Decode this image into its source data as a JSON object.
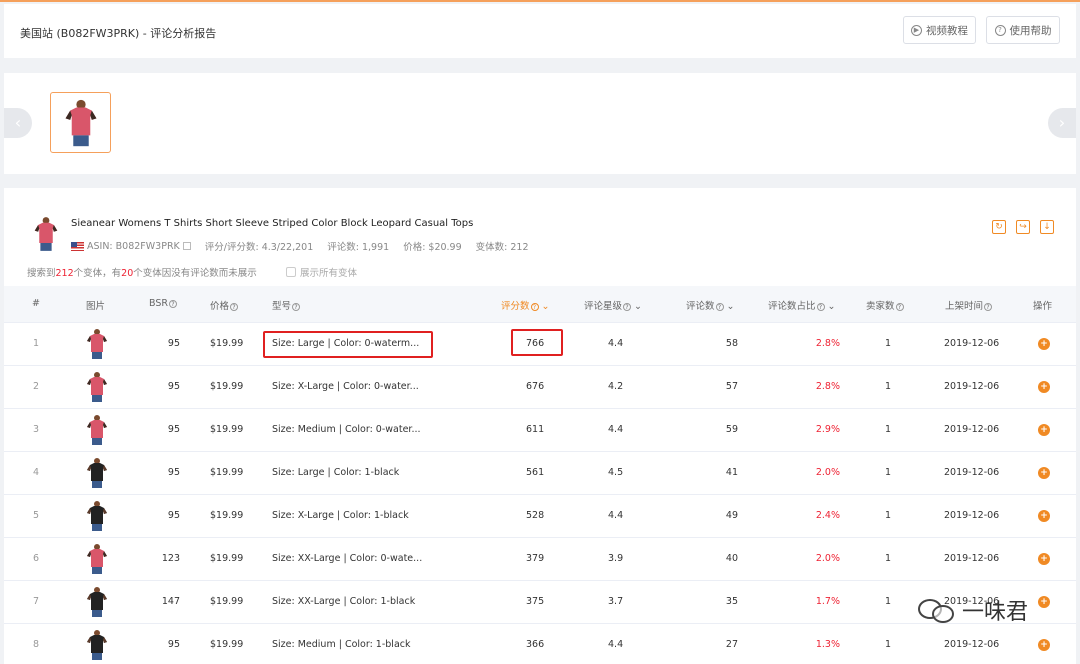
{
  "header": {
    "title": "美国站 (B082FW3PRK) - 评论分析报告",
    "video_label": "视频教程",
    "help_label": "使用帮助"
  },
  "gallery": {
    "prev_icon": "chevron-left-icon",
    "next_icon": "chevron-right-icon"
  },
  "product": {
    "title": "Sieanear Womens T Shirts Short Sleeve Striped Color Block Leopard Casual Tops",
    "asin": "ASIN: B082FW3PRK",
    "rating": "评分/评分数: 4.3/22,201",
    "reviews": "评论数: 1,991",
    "price": "价格: $20.99",
    "variants": "变体数: 212"
  },
  "variants_note": {
    "prefix": "搜索到",
    "count": "212",
    "mid": "个变体，有",
    "no_review_count": "20",
    "suffix": "个变体因没有评论数而未展示",
    "show_all_label": "展示所有变体"
  },
  "table": {
    "headers": {
      "index": "#",
      "image": "图片",
      "bsr": "BSR",
      "price": "价格",
      "model": "型号",
      "ratings": "评分数",
      "stars": "评论星级",
      "reviews": "评论数",
      "review_ratio": "评论数占比",
      "sellers": "卖家数",
      "listed": "上架时间",
      "action": "操作"
    },
    "rows": [
      {
        "index": "1",
        "color": "pink",
        "bsr": "95",
        "price": "$19.99",
        "model": "Size: Large | Color: 0-waterm...",
        "ratings": "766",
        "stars": "4.4",
        "reviews": "58",
        "ratio": "2.8%",
        "sellers": "1",
        "date": "2019-12-06"
      },
      {
        "index": "2",
        "color": "pink",
        "bsr": "95",
        "price": "$19.99",
        "model": "Size: X-Large | Color: 0-water...",
        "ratings": "676",
        "stars": "4.2",
        "reviews": "57",
        "ratio": "2.8%",
        "sellers": "1",
        "date": "2019-12-06"
      },
      {
        "index": "3",
        "color": "pink",
        "bsr": "95",
        "price": "$19.99",
        "model": "Size: Medium | Color: 0-water...",
        "ratings": "611",
        "stars": "4.4",
        "reviews": "59",
        "ratio": "2.9%",
        "sellers": "1",
        "date": "2019-12-06"
      },
      {
        "index": "4",
        "color": "black",
        "bsr": "95",
        "price": "$19.99",
        "model": "Size: Large | Color: 1-black",
        "ratings": "561",
        "stars": "4.5",
        "reviews": "41",
        "ratio": "2.0%",
        "sellers": "1",
        "date": "2019-12-06"
      },
      {
        "index": "5",
        "color": "black",
        "bsr": "95",
        "price": "$19.99",
        "model": "Size: X-Large | Color: 1-black",
        "ratings": "528",
        "stars": "4.4",
        "reviews": "49",
        "ratio": "2.4%",
        "sellers": "1",
        "date": "2019-12-06"
      },
      {
        "index": "6",
        "color": "pink",
        "bsr": "123",
        "price": "$19.99",
        "model": "Size: XX-Large | Color: 0-wate...",
        "ratings": "379",
        "stars": "3.9",
        "reviews": "40",
        "ratio": "2.0%",
        "sellers": "1",
        "date": "2019-12-06"
      },
      {
        "index": "7",
        "color": "black",
        "bsr": "147",
        "price": "$19.99",
        "model": "Size: XX-Large | Color: 1-black",
        "ratings": "375",
        "stars": "3.7",
        "reviews": "35",
        "ratio": "1.7%",
        "sellers": "1",
        "date": "2019-12-06"
      },
      {
        "index": "8",
        "color": "black",
        "bsr": "95",
        "price": "$19.99",
        "model": "Size: Medium | Color: 1-black",
        "ratings": "366",
        "stars": "4.4",
        "reviews": "27",
        "ratio": "1.3%",
        "sellers": "1",
        "date": "2019-12-06"
      }
    ]
  },
  "watermark": {
    "text": "一味君",
    "icon": "wechat-icon"
  },
  "colors": {
    "accent": "#f08a24",
    "highlight": "#e02020",
    "ratio_red": "#e23",
    "pink_shirt": "#d9566a",
    "black_shirt": "#222222"
  }
}
